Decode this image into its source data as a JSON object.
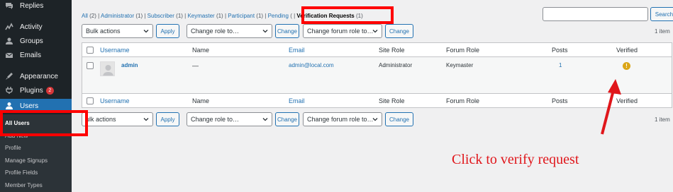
{
  "sidebar": {
    "items": [
      {
        "label": "Replies",
        "icon": "replies-icon"
      },
      {
        "label": "Activity",
        "icon": "activity-icon"
      },
      {
        "label": "Groups",
        "icon": "groups-icon"
      },
      {
        "label": "Emails",
        "icon": "emails-icon"
      },
      {
        "label": "Appearance",
        "icon": "appearance-icon"
      },
      {
        "label": "Plugins",
        "icon": "plugins-icon",
        "badge": "2"
      },
      {
        "label": "Users",
        "icon": "users-icon"
      }
    ],
    "submenu": [
      "All Users",
      "Add New",
      "Profile",
      "Manage Signups",
      "Profile Fields",
      "Member Types"
    ]
  },
  "views": {
    "all": "All",
    "all_count": "(2)",
    "administrator": "Administrator",
    "administrator_count": "(1)",
    "subscriber": "Subscriber",
    "subscriber_count": "(1)",
    "keymaster": "Keymaster",
    "keymaster_count": "(1)",
    "participant": "Participant",
    "participant_count": "(1)",
    "pending": "Pending",
    "pending_count": "(",
    "verification": "Verification Requests",
    "verification_count": "(1)"
  },
  "search": {
    "button_label": "Search Users",
    "value": ""
  },
  "top_nav": {
    "bulk_actions": "Bulk actions",
    "apply": "Apply",
    "change_role": "Change role to…",
    "change": "Change",
    "change_forum_role": "Change forum role to…",
    "change_forum": "Change",
    "items_count": "1 item"
  },
  "bottom_nav": {
    "bulk_actions": "ulk actions",
    "apply": "Apply",
    "change_role": "Change role to…",
    "change": "Change",
    "change_forum_role": "Change forum role to…",
    "change_forum": "Change",
    "items_count": "1 item"
  },
  "table": {
    "columns": [
      "Username",
      "Name",
      "Email",
      "Site Role",
      "Forum Role",
      "Posts",
      "Verified"
    ],
    "rows": [
      {
        "username": "admin",
        "name": "—",
        "email": "admin@local.com",
        "site_role": "Administrator",
        "forum_role": "Keymaster",
        "posts": "1",
        "verified_icon": "!"
      }
    ]
  },
  "annotation": {
    "text": "Click to verify request",
    "color": "#e0161b"
  }
}
